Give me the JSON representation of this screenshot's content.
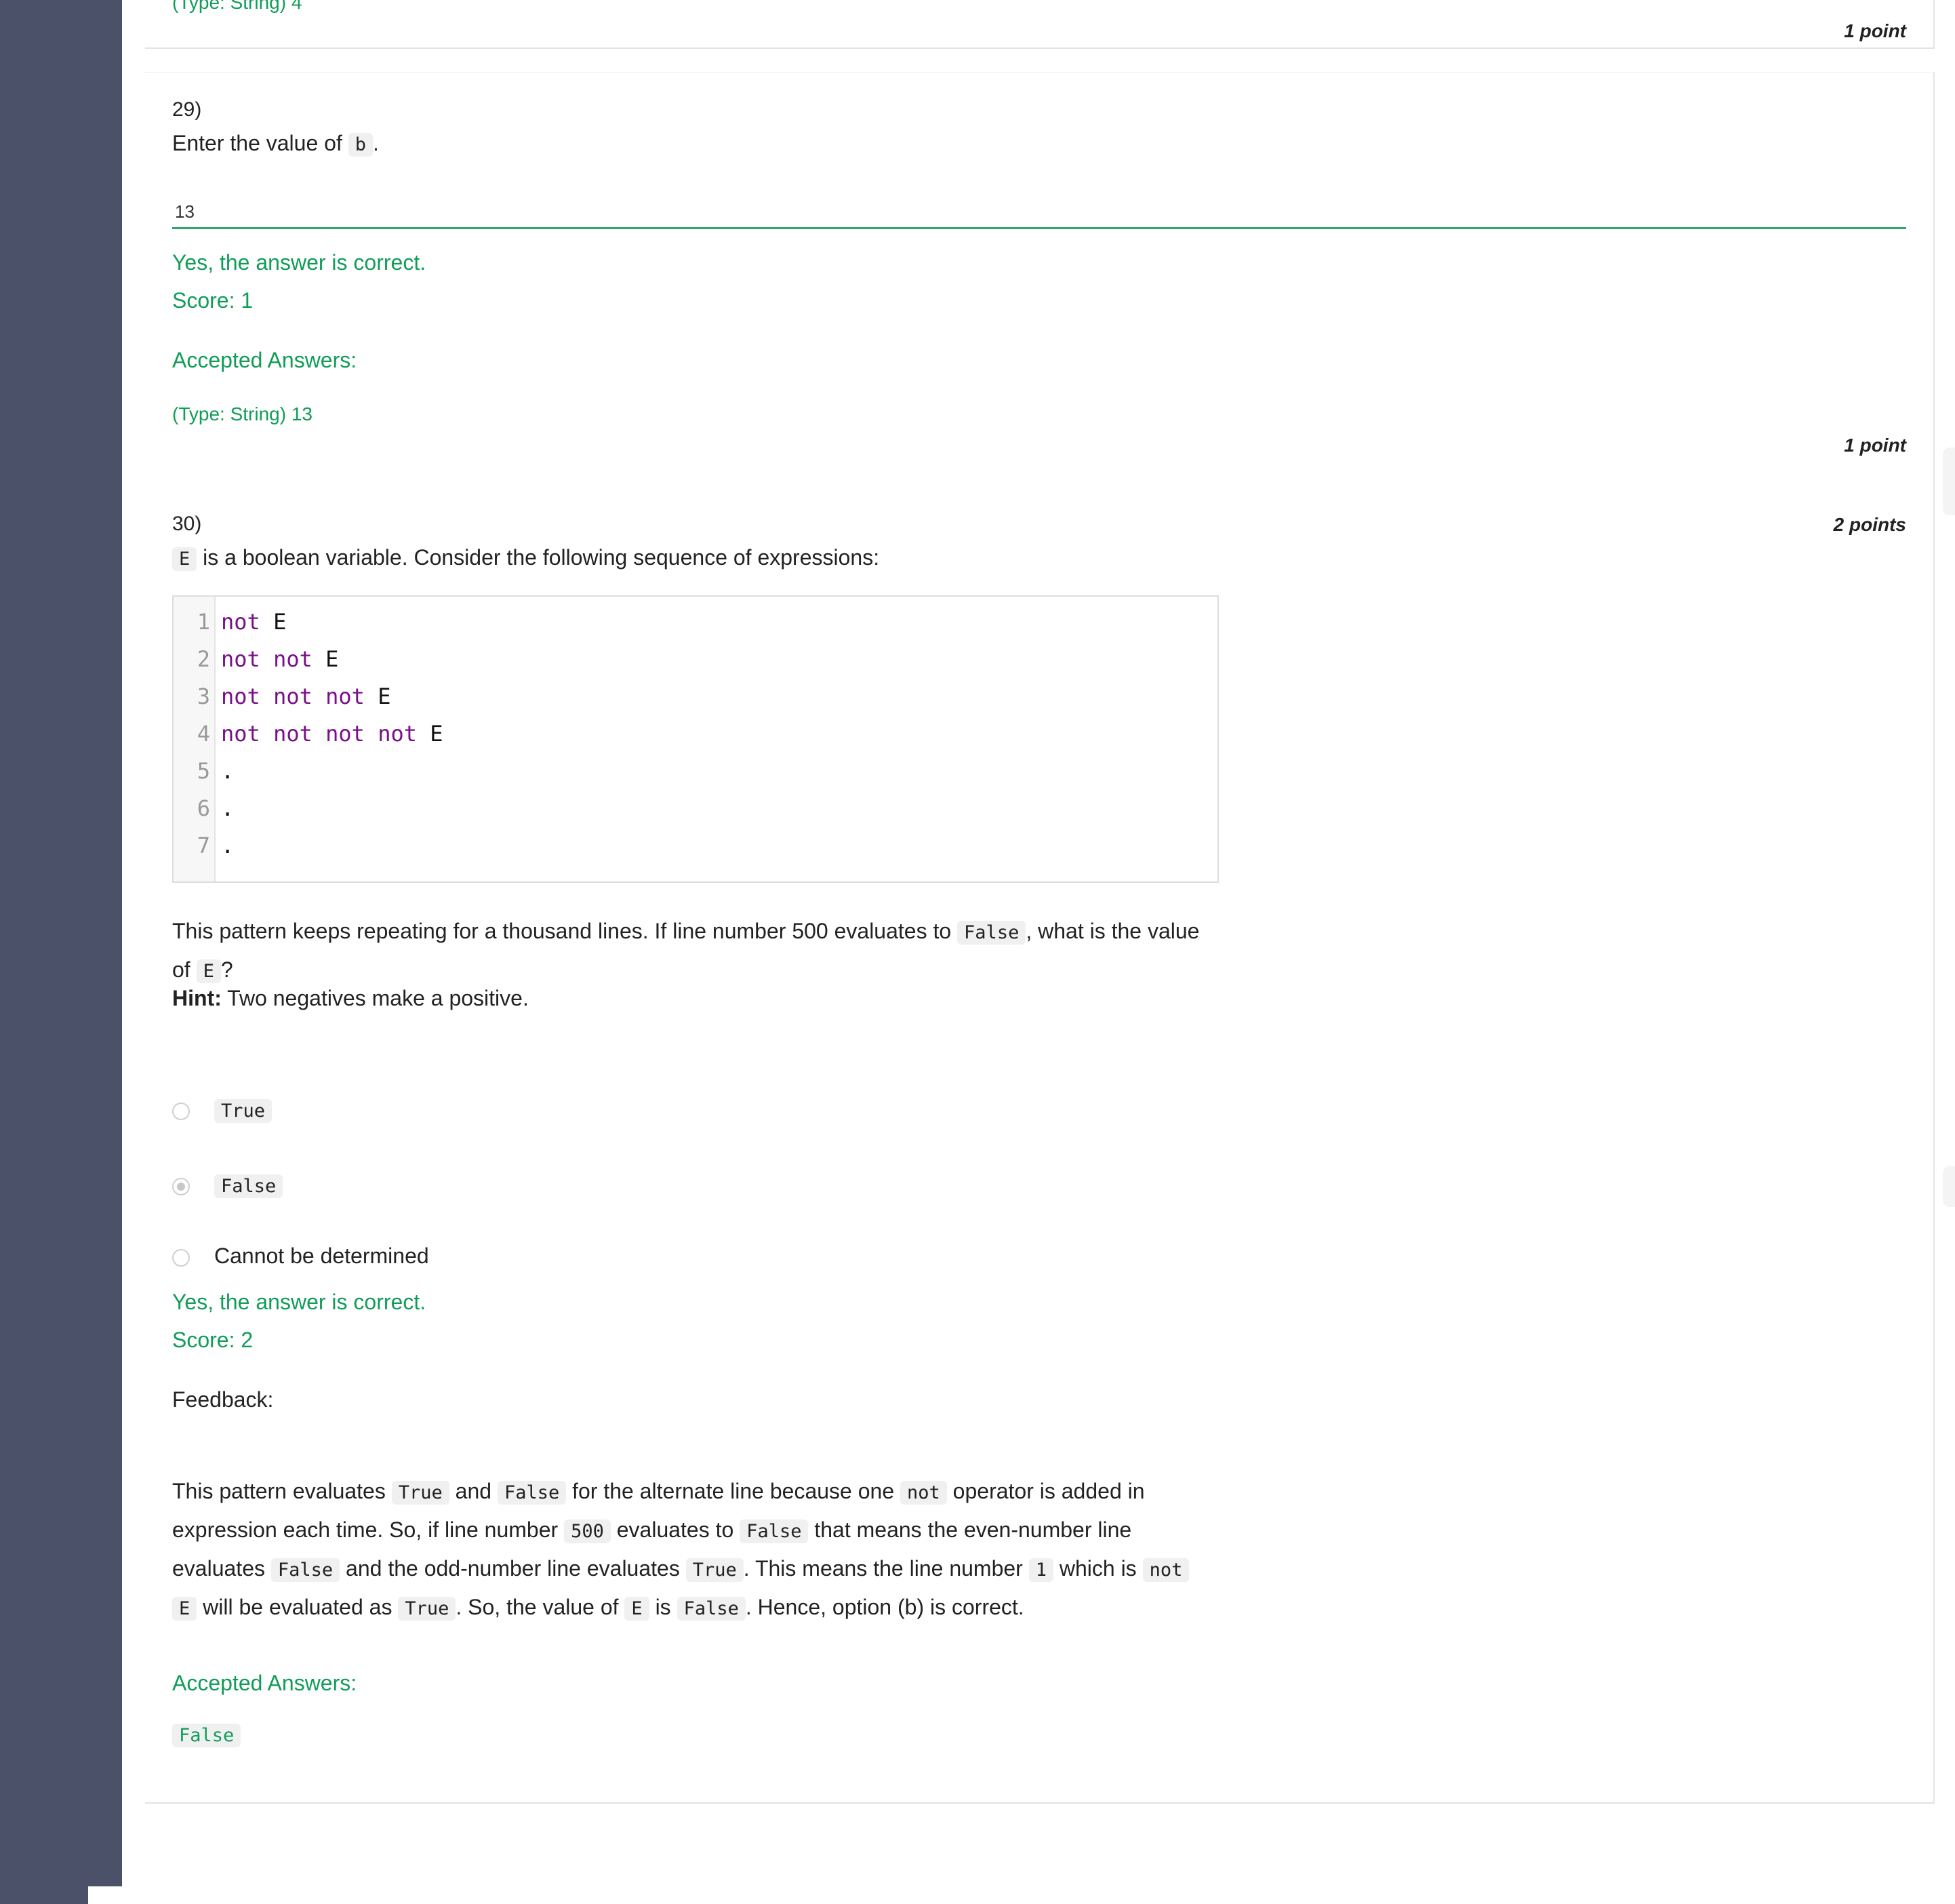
{
  "q28": {
    "accepted_answer_tail": "(Type: String) 4",
    "points": "1 point"
  },
  "q29": {
    "number": "29)",
    "question_prefix": "Enter the value of",
    "question_code": "b",
    "question_suffix": ".",
    "answer_value": "13",
    "result_text": "Yes, the answer is correct.",
    "score_text": "Score: 1",
    "accepted_label": "Accepted Answers:",
    "accepted_answer": "(Type: String) 13",
    "points": "1 point"
  },
  "q30": {
    "number": "30)",
    "points": "2 points",
    "intro_code": "E",
    "intro_text": "is a boolean variable. Consider the following sequence of expressions:",
    "code_lines": [
      {
        "n": "1",
        "kw": "not",
        "rest": " E"
      },
      {
        "n": "2",
        "kw": "not not",
        "rest": " E"
      },
      {
        "n": "3",
        "kw": "not not not",
        "rest": " E"
      },
      {
        "n": "4",
        "kw": "not not not not",
        "rest": " E"
      },
      {
        "n": "5",
        "kw": "",
        "rest": "."
      },
      {
        "n": "6",
        "kw": "",
        "rest": "."
      },
      {
        "n": "7",
        "kw": "",
        "rest": "."
      }
    ],
    "body_p1": "This pattern keeps repeating for a thousand lines. If line number 500 evaluates to",
    "body_code1": "False",
    "body_p2": ", what is the value",
    "body_p3": "of",
    "body_code2": "E",
    "body_p4": "?",
    "hint_label": "Hint:",
    "hint_text": "Two negatives make a positive.",
    "options": [
      {
        "label": "True",
        "is_code": true,
        "selected": false
      },
      {
        "label": "False",
        "is_code": true,
        "selected": true
      },
      {
        "label": "Cannot be determined",
        "is_code": false,
        "selected": false
      }
    ],
    "result_text": "Yes, the answer is correct.",
    "score_text": "Score: 2",
    "feedback_label": "Feedback:",
    "feedback": {
      "t1": "This pattern evaluates",
      "c1": "True",
      "t2": "and",
      "c2": "False",
      "t3": "for the alternate line because one",
      "c3": "not",
      "t4": "operator is added in",
      "t5": "expression each time. So, if line number",
      "c4": "500",
      "t6": "evaluates to",
      "c5": "False",
      "t7": "that means the even-number line",
      "t8": "evaluates",
      "c6": "False",
      "t9": "and the odd-number line evaluates",
      "c7": "True",
      "t10": ". This means the line number",
      "c8": "1",
      "t11": "which is",
      "c9": "not",
      "c10": "E",
      "t12": "will be evaluated as",
      "c11": "True",
      "t13": ". So, the value of",
      "c12": "E",
      "t14": "is",
      "c13": "False",
      "t15": ". Hence, option (b) is correct."
    },
    "accepted_label": "Accepted Answers:",
    "accepted_answer": "False"
  },
  "colors": {
    "sidebar": "#4a5169",
    "correct_green": "#109d58",
    "keyword_purple": "#7a0f8a"
  }
}
